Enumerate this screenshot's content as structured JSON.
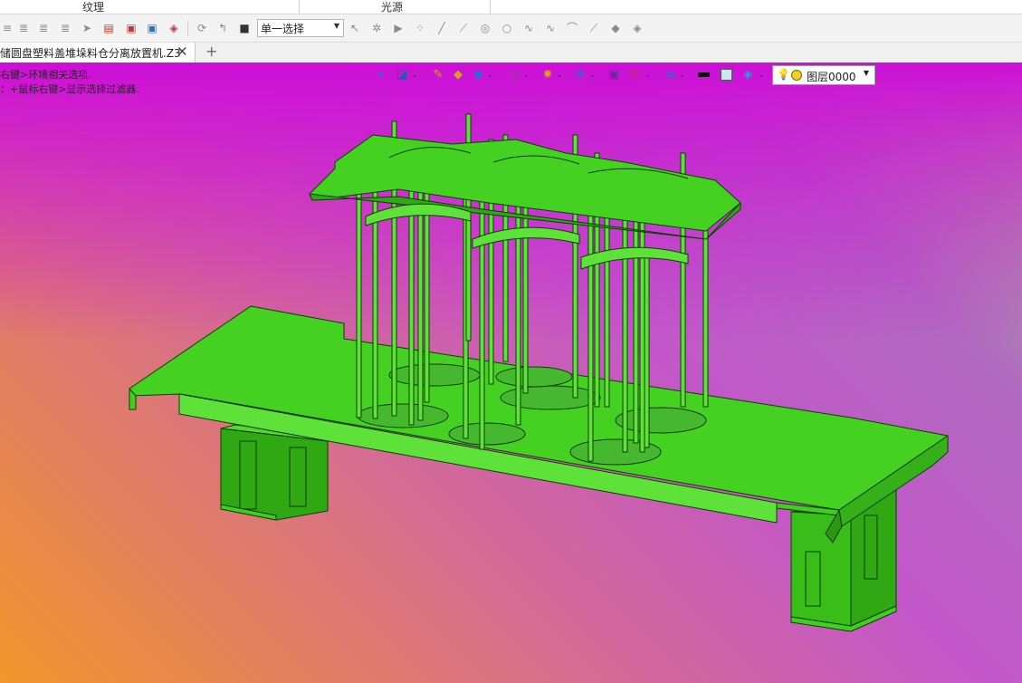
{
  "ribbon": {
    "group_left": "纹理",
    "group_right": "光源"
  },
  "toolbar": {
    "selection_mode": "单一选择",
    "icons": [
      "list-icon",
      "list-icon",
      "list-icon",
      "cursor-icon",
      "table-icon",
      "import-icon",
      "export-icon",
      "sync-icon",
      "rotate-icon",
      "path-icon",
      "stop-icon",
      "arrow-select-icon",
      "target-select-icon",
      "play-icon",
      "scatter-icon",
      "line-icon",
      "line-icon",
      "circle-center-icon",
      "circle-icon",
      "curve-icon",
      "wave-icon",
      "arc-icon",
      "pen-icon",
      "layers-icon",
      "stack-icon"
    ]
  },
  "tabs": [
    {
      "label": "储圆盘塑料盖堆垛料仓分离放置机.Z3",
      "active": true
    }
  ],
  "hints": [
    "右键>环境相关选项.",
    "：+鼠标右键>显示选择过滤器."
  ],
  "view_toolbar": {
    "layer_label": "图层0000",
    "icons": [
      "export-view-icon",
      "display-mode-icon",
      "pencil-icon",
      "part-icon",
      "cube-shaded-icon",
      "cube-view-icon",
      "render-icon",
      "zoom-icon",
      "frame-icon",
      "section-icon",
      "monitor-icon",
      "line-color-icon",
      "fill-color-icon",
      "plane-icon"
    ]
  },
  "colors": {
    "model_fill": "#3fcf1c",
    "model_edge": "#0d3d05",
    "viewport_top": "#cd0fd7",
    "viewport_bottom_left": "#f0962a",
    "viewport_bottom_right": "#a6c98a"
  }
}
